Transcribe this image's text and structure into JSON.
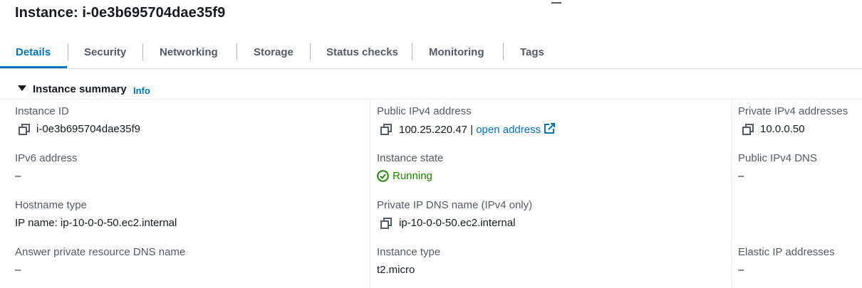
{
  "page": {
    "title": "Instance: i-0e3b695704dae35f9"
  },
  "tabs": [
    {
      "label": "Details",
      "active": true
    },
    {
      "label": "Security"
    },
    {
      "label": "Networking"
    },
    {
      "label": "Storage"
    },
    {
      "label": "Status checks"
    },
    {
      "label": "Monitoring"
    },
    {
      "label": "Tags"
    }
  ],
  "summary": {
    "title": "Instance summary",
    "info_label": "Info"
  },
  "fields": {
    "instance_id": {
      "label": "Instance ID",
      "value": "i-0e3b695704dae35f9"
    },
    "ipv6": {
      "label": "IPv6 address",
      "value": "–"
    },
    "hostname_type": {
      "label": "Hostname type",
      "value": "IP name: ip-10-0-0-50.ec2.internal"
    },
    "answer_dns": {
      "label": "Answer private resource DNS name",
      "value": "–"
    },
    "public_ipv4": {
      "label": "Public IPv4 address",
      "value": "100.25.220.47",
      "separator": "|",
      "link_label": "open address"
    },
    "instance_state": {
      "label": "Instance state",
      "value": "Running",
      "color": "#1d8102"
    },
    "private_ip_dns": {
      "label": "Private IP DNS name (IPv4 only)",
      "value": "ip-10-0-0-50.ec2.internal"
    },
    "instance_type": {
      "label": "Instance type",
      "value": "t2.micro"
    },
    "private_ipv4": {
      "label": "Private IPv4 addresses",
      "value": "10.0.0.50"
    },
    "public_dns": {
      "label": "Public IPv4 DNS",
      "value": "–"
    },
    "elastic_ip": {
      "label": "Elastic IP addresses",
      "value": "–"
    }
  },
  "icons": {
    "copy": "copy-icon",
    "external": "external-link-icon",
    "status": "check-circle-icon",
    "caret": "caret-down-icon"
  },
  "colors": {
    "link": "#0073bb",
    "active_tab": "#0073bb",
    "success": "#1d8102"
  }
}
